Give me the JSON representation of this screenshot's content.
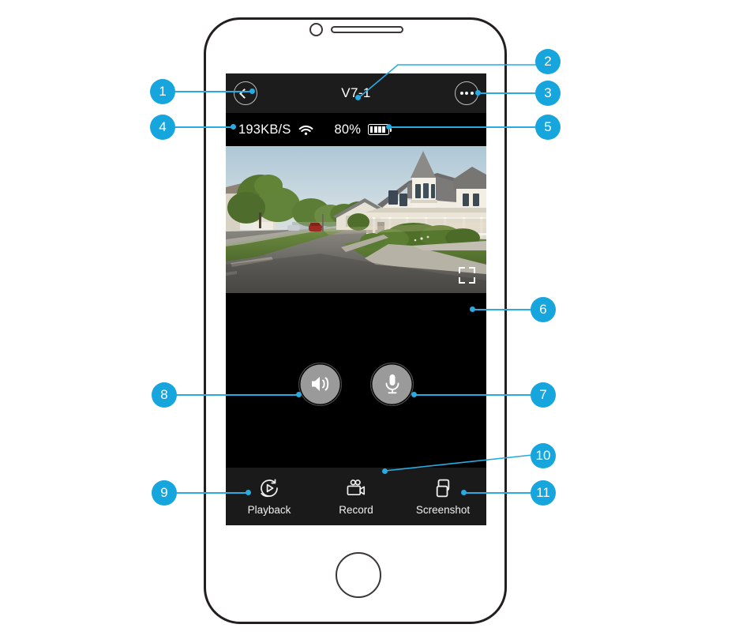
{
  "app": {
    "header": {
      "title": "V7-1",
      "back_icon": "chevron-left-icon",
      "more_icon": "ellipsis-icon"
    },
    "status": {
      "bitrate": "193KB/S",
      "wifi_icon": "wifi-icon",
      "battery_percent": "80%",
      "battery_icon": "battery-icon",
      "battery_bars": 4
    },
    "video": {
      "fullscreen_icon": "fullscreen-expand-icon",
      "scene_description": "suburban street with white victorian house"
    },
    "controls": [
      {
        "name": "speaker-button",
        "icon": "speaker-volume-icon"
      },
      {
        "name": "microphone-button",
        "icon": "microphone-icon"
      }
    ],
    "toolbar": [
      {
        "label": "Playback",
        "icon": "replay-circle-play-icon"
      },
      {
        "label": "Record",
        "icon": "movie-camera-icon"
      },
      {
        "label": "Screenshot",
        "icon": "two-frames-icon"
      }
    ]
  },
  "callouts": [
    {
      "number": "1",
      "target": "back-button"
    },
    {
      "number": "2",
      "target": "title"
    },
    {
      "number": "3",
      "target": "more-button"
    },
    {
      "number": "4",
      "target": "bitrate-and-wifi"
    },
    {
      "number": "5",
      "target": "battery-status"
    },
    {
      "number": "6",
      "target": "fullscreen-button"
    },
    {
      "number": "7",
      "target": "microphone-button"
    },
    {
      "number": "8",
      "target": "speaker-button"
    },
    {
      "number": "9",
      "target": "playback-button"
    },
    {
      "number": "10",
      "target": "record-button"
    },
    {
      "number": "11",
      "target": "screenshot-button"
    }
  ],
  "colors": {
    "accent": "#29abe2",
    "badge": "#16a5dd",
    "header_bg": "#1c1c1c",
    "screen_bg": "#000000",
    "toolbar_bg": "#1a1a1a",
    "frame": "#231f20",
    "control_button": "#9a9a9a"
  }
}
